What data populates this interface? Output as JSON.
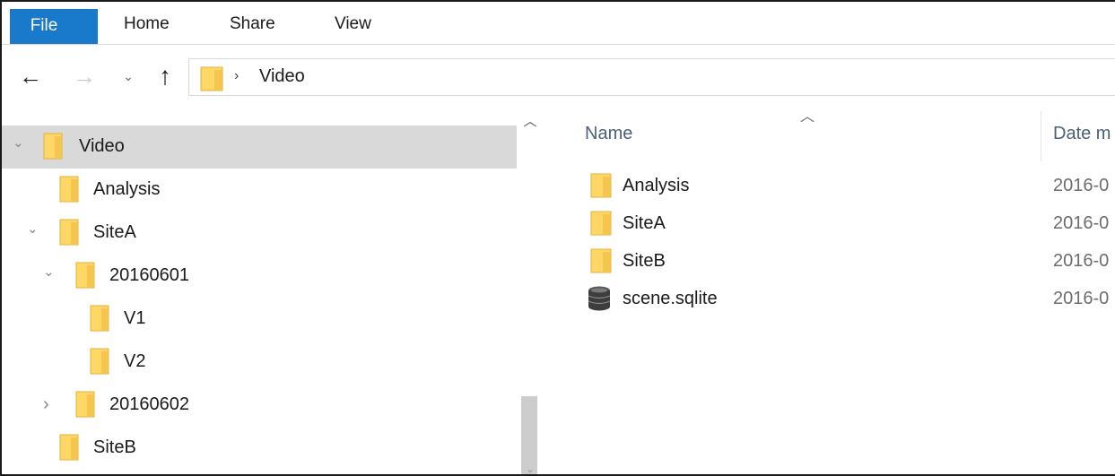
{
  "ribbon": {
    "tabs": [
      "File",
      "Home",
      "Share",
      "View"
    ]
  },
  "nav": {
    "back_icon": "arrow-left",
    "forward_icon": "arrow-right",
    "recent_icon": "chevron-down",
    "up_icon": "arrow-up"
  },
  "address": {
    "separator": "›",
    "path": "Video"
  },
  "tree": {
    "items": [
      {
        "label": "Video",
        "chevron": "⌄",
        "selected": true
      },
      {
        "label": "Analysis",
        "chevron": ""
      },
      {
        "label": "SiteA",
        "chevron": "⌄"
      },
      {
        "label": "20160601",
        "chevron": "⌄"
      },
      {
        "label": "V1",
        "chevron": ""
      },
      {
        "label": "V2",
        "chevron": ""
      },
      {
        "label": "20160602",
        "chevron": "›"
      },
      {
        "label": "SiteB",
        "chevron": ""
      }
    ]
  },
  "content": {
    "columns": {
      "name": "Name",
      "date": "Date m"
    },
    "rows": [
      {
        "name": "Analysis",
        "date": "2016-0",
        "icon": "folder-icon"
      },
      {
        "name": "SiteA",
        "date": "2016-0",
        "icon": "folder-icon"
      },
      {
        "name": "SiteB",
        "date": "2016-0",
        "icon": "folder-icon"
      },
      {
        "name": "scene.sqlite",
        "date": "2016-0",
        "icon": "database-icon"
      }
    ]
  },
  "colors": {
    "accent": "#1979ca",
    "folder": "#ffd766",
    "selected": "#d9d9d9"
  }
}
